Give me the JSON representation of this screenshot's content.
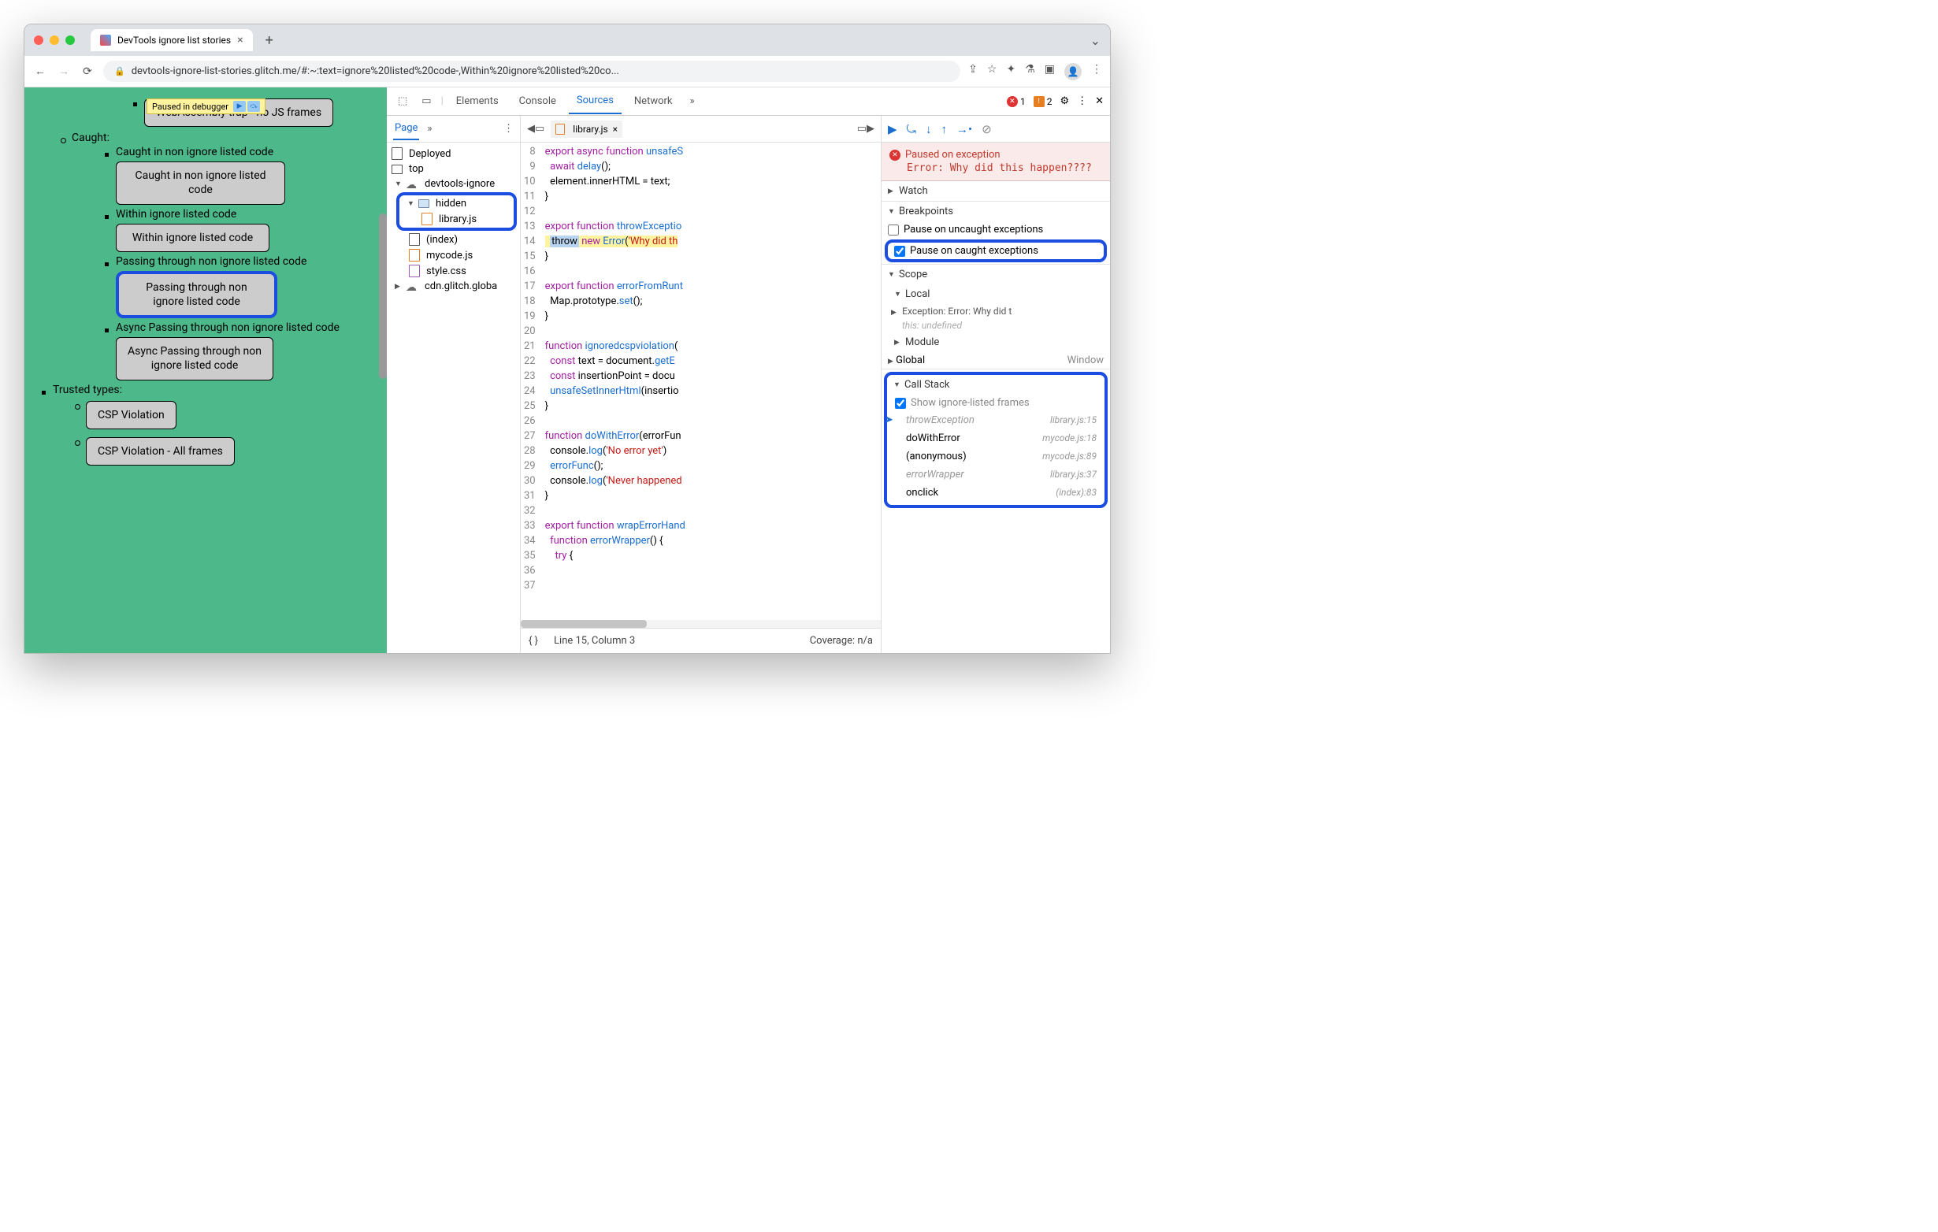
{
  "browser": {
    "tab_title": "DevTools ignore list stories",
    "url": "devtools-ignore-list-stories.glitch.me/#:~:text=ignore%20listed%20code-,Within%20ignore%20listed%20co..."
  },
  "page_overlay": {
    "paused_label": "Paused in debugger"
  },
  "page_content": {
    "btn_wasm": "WebAssembly trap - no JS frames",
    "caught_header": "Caught:",
    "li_caught_non_ignore": "Caught in non ignore listed code",
    "btn_caught_non_ignore": "Caught in non ignore listed code",
    "li_within": "Within ignore listed code",
    "btn_within": "Within ignore listed code",
    "li_passing": "Passing through non ignore listed code",
    "btn_passing": "Passing through non ignore listed code",
    "li_async_passing": "Async Passing through non ignore listed code",
    "btn_async_passing": "Async Passing through non ignore listed code",
    "trusted_header": "Trusted types:",
    "btn_csp": "CSP Violation",
    "btn_csp_all": "CSP Violation - All frames"
  },
  "devtools": {
    "tabs": {
      "elements": "Elements",
      "console": "Console",
      "sources": "Sources",
      "network": "Network"
    },
    "error_count": "1",
    "issue_count": "2",
    "nav": {
      "page_tab": "Page",
      "deployed": "Deployed",
      "top": "top",
      "domain": "devtools-ignore",
      "hidden": "hidden",
      "library": "library.js",
      "index": "(index)",
      "mycode": "mycode.js",
      "style": "style.css",
      "cdn": "cdn.glitch.globa"
    },
    "editor": {
      "tab_file": "library.js",
      "lines": {
        "8": "export async function unsafeS",
        "9": "  await delay();",
        "10": "  element.innerHTML = text;",
        "11": "}",
        "12": "",
        "13": "export function throwExceptio",
        "14": "  throw new Error('Why did th",
        "15": "}",
        "16": "",
        "17": "export function errorFromRunt",
        "18": "  Map.prototype.set();",
        "19": "}",
        "20": "",
        "21": "function ignoredcspviolation(",
        "22": "  const text = document.getE",
        "23": "  const insertionPoint = docu",
        "24": "  unsafeSetInnerHtml(insertio",
        "25": "}",
        "26": "",
        "27": "function doWithError(errorFun",
        "28": "  console.log('No error yet')",
        "29": "  errorFunc();",
        "30": "  console.log('Never happened",
        "31": "}",
        "32": "",
        "33": "export function wrapErrorHand",
        "34": "  function errorWrapper() {",
        "35": "    try {"
      },
      "status_line": "Line 15, Column 3",
      "status_coverage": "Coverage: n/a"
    },
    "debugger": {
      "paused_title": "Paused on exception",
      "paused_error": "Error: Why did this happen????",
      "watch": "Watch",
      "breakpoints": "Breakpoints",
      "bp_uncaught": "Pause on uncaught exceptions",
      "bp_caught": "Pause on caught exceptions",
      "scope": "Scope",
      "scope_local": "Local",
      "scope_exception": "Exception: Error: Why did t",
      "scope_this": "this: undefined",
      "scope_module": "Module",
      "scope_global": "Global",
      "scope_global_val": "Window",
      "callstack": "Call Stack",
      "cs_show_ignored": "Show ignore-listed frames",
      "frames": [
        {
          "fn": "throwException",
          "loc": "library.js:15",
          "ign": true,
          "cur": true
        },
        {
          "fn": "doWithError",
          "loc": "mycode.js:18",
          "ign": false
        },
        {
          "fn": "(anonymous)",
          "loc": "mycode.js:89",
          "ign": false
        },
        {
          "fn": "errorWrapper",
          "loc": "library.js:37",
          "ign": true
        },
        {
          "fn": "onclick",
          "loc": "(index):83",
          "ign": false
        }
      ]
    }
  }
}
